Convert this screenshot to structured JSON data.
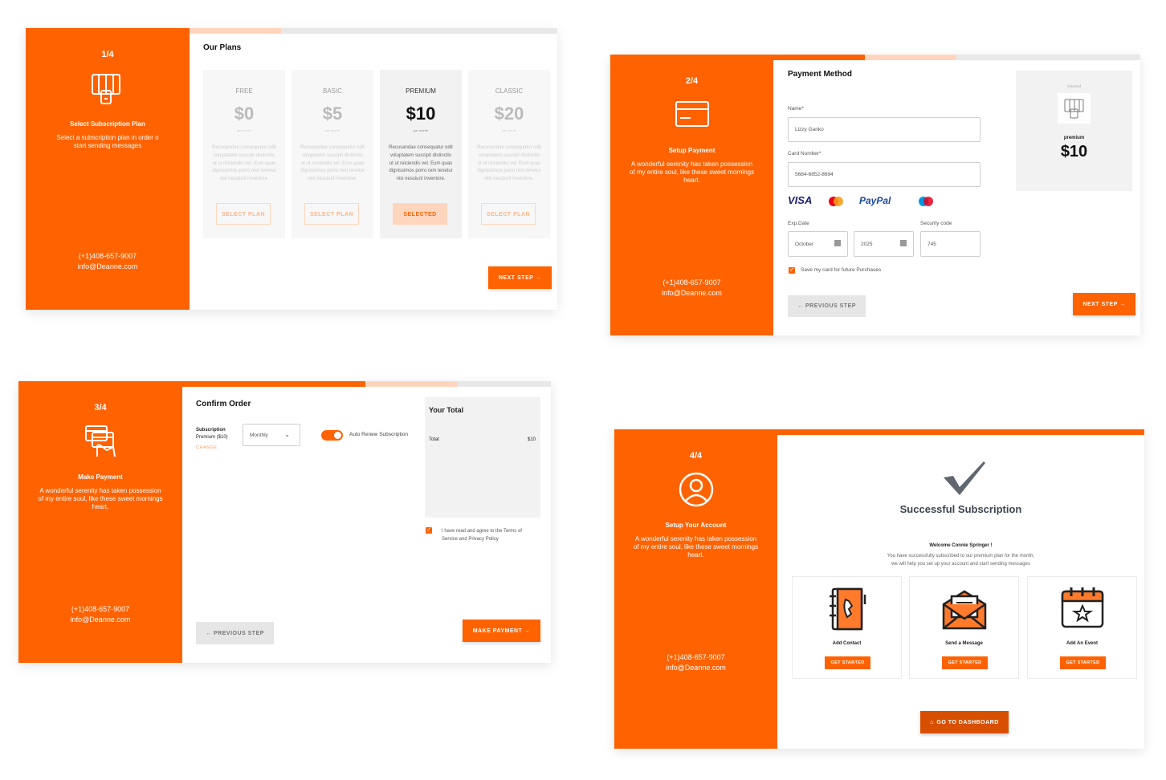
{
  "screen1": {
    "step": "1/4",
    "side_title": "Select Subscription Plan",
    "side_desc": "Select a subscription plan in order o start sending messages",
    "phone": "(+1)408-657-9007",
    "email": "info@Deanne.com",
    "heading": "Our Plans",
    "plans": [
      {
        "name": "FREE",
        "price": "$0",
        "per": "per month",
        "desc": "Recusandae consequatur odit voluptatem suscipit distinctio ut ut reiciendis vel. Eum quas dignissimos porro rem tenetur nisi nesciunt inventore.",
        "button": "SELECT PLAN"
      },
      {
        "name": "BASIC",
        "price": "$5",
        "per": "per month",
        "desc": "Recusandae consequatur odit voluptatem suscipit distinctio ut ut reiciendis vel. Eum quas dignissimos porro rem tenetur nisi nesciunt inventore.",
        "button": "SELECT PLAN"
      },
      {
        "name": "PREMIUM",
        "price": "$10",
        "per": "per month",
        "desc": "Recusandae consequatur odit voluptatem suscipit distinctio ut ut reiciendis vel. Eum quas dignissimos porro rem tenetur nisi nesciunt inventore.",
        "button": "SELECTED"
      },
      {
        "name": "CLASSIC",
        "price": "$20",
        "per": "per month",
        "desc": "Recusandae consequatur odit voluptatem suscipit distinctio ut ut reiciendis vel. Eum quas dignissimos porro rem tenetur nisi nesciunt inventore.",
        "button": "SELECT PLAN"
      }
    ],
    "next": "NEXT STEP →"
  },
  "screen2": {
    "step": "2/4",
    "side_title": "Setup Payment",
    "side_desc": "A wonderful serenity has taken possession of my entire soul, like these sweet mornings heart.",
    "phone": "(+1)408-657-9007",
    "email": "info@Deanne.com",
    "heading": "Payment Method",
    "name_label": "Name*",
    "name_value": "Lizzy Ganko",
    "card_label": "Card Number*",
    "card_value": "5684-6852-8694",
    "card_brands": [
      "VISA",
      "mastercard",
      "PayPal",
      "Maestro"
    ],
    "exp_label": "Exp.Date",
    "exp_month": "October",
    "exp_year": "2025",
    "sec_label": "Security code",
    "sec_value": "745",
    "save_label": "Save my card for future Purchases",
    "selected_label": "Selected",
    "selected_plan": "premium",
    "selected_price": "$10",
    "prev": "← PREVIOUS STEP",
    "next": "NEXT STEP →"
  },
  "screen3": {
    "step": "3/4",
    "side_title": "Make Payment",
    "side_desc": "A wonderful serenity has taken possession of my entire soul, like these sweet mornings heart.",
    "phone": "(+1)408-657-9007",
    "email": "info@Deanne.com",
    "heading": "Confirm Order",
    "sub_label": "Subscription",
    "sub_value": "Premium ($10)",
    "change": "CHANGE",
    "period": "Monthly",
    "auto_renew": "Auto Renew Subscription",
    "total_heading": "Your Total",
    "total_label": "Total",
    "total_value": "$10",
    "terms": "I have read and agree to the Terms of Service and Privacy Policy",
    "prev": "← PREVIOUS STEP",
    "pay": "MAKE PAYMENT →"
  },
  "screen4": {
    "step": "4/4",
    "side_title": "Setup Your Account",
    "side_desc": "A wonderful serenity has taken possession of my entire soul, like these sweet mornings heart.",
    "phone": "(+1)408-657-9007",
    "email": "info@Deanne.com",
    "success_title": "Successful Subscription",
    "welcome": "Welcome Connie Springer !",
    "message_line1": "You have successfully subscribed to our premium plan for the month,",
    "message_line2": "we will help you set up your account and start sending messages",
    "features": [
      {
        "title": "Add Contact",
        "button": "GET STARTED",
        "icon": "contact-book-icon"
      },
      {
        "title": "Send a Message",
        "button": "GET STARTED",
        "icon": "envelope-icon"
      },
      {
        "title": "Add An Event",
        "button": "GET STARTED",
        "icon": "calendar-icon"
      }
    ],
    "dashboard": "GO TO DASHBOARD"
  },
  "colors": {
    "accent": "#ff6200",
    "accent_light": "#ffd6bd",
    "progress_bg": "#e8e8e8"
  }
}
